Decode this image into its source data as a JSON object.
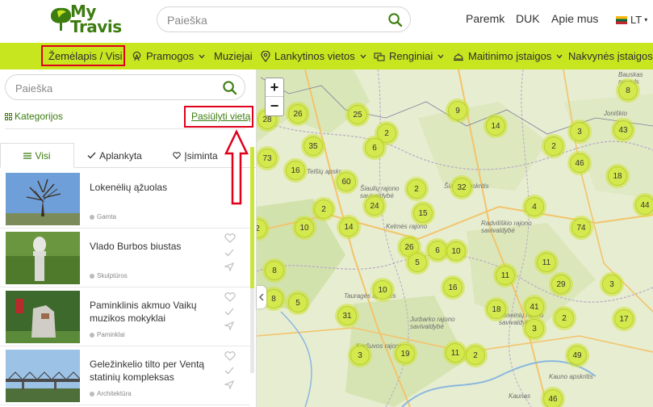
{
  "header": {
    "logo_text_1": "My",
    "logo_text_2": "Travis",
    "search_placeholder": "Paieška",
    "nav": [
      "Paremk",
      "DUK",
      "Apie mus"
    ],
    "language": "LT"
  },
  "navbar": {
    "items": [
      {
        "label": "Žemėlapis / Visi",
        "icon": ""
      },
      {
        "label": "Pramogos",
        "icon": "ferris-wheel-icon"
      },
      {
        "label": "Muziejai",
        "icon": ""
      },
      {
        "label": "Lankytinos vietos",
        "icon": "pin-icon"
      },
      {
        "label": "Renginiai",
        "icon": "tickets-icon"
      },
      {
        "label": "Maitinimo įstaigos",
        "icon": "cloche-icon"
      },
      {
        "label": "Nakvynės įstaigos",
        "icon": ""
      }
    ]
  },
  "sidebar": {
    "search_placeholder": "Paieška",
    "categories_label": "Kategorijos",
    "suggest_label": "Pasiūlyti vietą",
    "tabs": [
      "Visi",
      "Aplankyta",
      "Įsiminta"
    ],
    "items": [
      {
        "title": "Lokenėlių ąžuolas",
        "category": "Gamta"
      },
      {
        "title": "Vlado Burbos biustas",
        "category": "Skulptūros"
      },
      {
        "title": "Paminklinis akmuo Vaikų muzikos mokyklai",
        "category": "Paminklai"
      },
      {
        "title": "Geležinkelio tilto per Ventą statinių kompleksas",
        "category": "Architektūra"
      }
    ]
  },
  "map": {
    "zoom_in": "+",
    "zoom_out": "−",
    "labels": [
      "Bauskas novads",
      "Telšių apskr.",
      "Šiaulių apskritis",
      "Šiaulių rajono savivaldybė",
      "Kelmės rajono",
      "Radviliškio rajono savivaldybė",
      "Tauragės apskritis",
      "Jurbarko rajono savivaldybė",
      "Raseinių rajono savivaldybė",
      "Kauno apskritis",
      "Kaunas",
      "Koršuvos rajono",
      "Joniškio"
    ],
    "clusters": [
      "28",
      "26",
      "25",
      "9",
      "14",
      "8",
      "2",
      "6",
      "35",
      "73",
      "16",
      "60",
      "2",
      "32",
      "3",
      "2",
      "46",
      "43",
      "18",
      "2",
      "10",
      "14",
      "24",
      "15",
      "4",
      "44",
      "74",
      "2",
      "26",
      "6",
      "10",
      "5",
      "8",
      "11",
      "11",
      "10",
      "16",
      "8",
      "5",
      "29",
      "3",
      "31",
      "18",
      "41",
      "2",
      "3",
      "17",
      "3",
      "19",
      "11",
      "2",
      "49",
      "46"
    ]
  }
}
